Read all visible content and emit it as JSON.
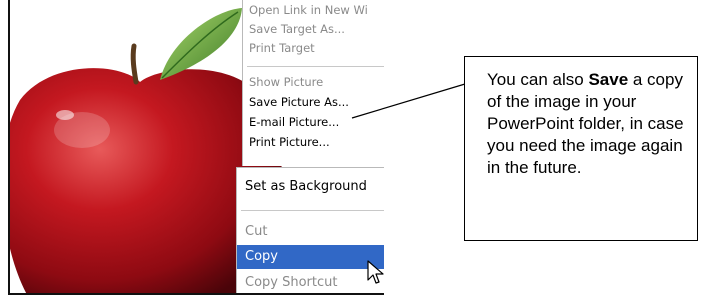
{
  "context_menu_top": {
    "items": [
      {
        "label": "Open Link in New Wi",
        "state": "disabled"
      },
      {
        "label": "Save Target As...",
        "state": "disabled"
      },
      {
        "label": "Print Target",
        "state": "disabled"
      },
      {
        "label": "Show Picture",
        "state": "disabled"
      },
      {
        "label": "Save Picture As...",
        "state": "enabled"
      },
      {
        "label": "E-mail Picture...",
        "state": "enabled"
      },
      {
        "label": "Print Picture...",
        "state": "enabled"
      }
    ]
  },
  "context_menu_bottom": {
    "items": [
      {
        "label": "Set as Background",
        "state": "enabled"
      },
      {
        "label": "Cut",
        "state": "disabled"
      },
      {
        "label": "Copy",
        "state": "highlighted"
      },
      {
        "label": "Copy Shortcut",
        "state": "disabled"
      }
    ],
    "highlight_color": "#3168c6"
  },
  "callout": {
    "text_before": "You can also ",
    "text_bold": "Save",
    "text_after": " a copy of the image in your PowerPoint folder, in case you need the image again in the future."
  },
  "cursor": {
    "icon": "arrow-pointer-icon"
  },
  "image": {
    "subject": "apple-icon",
    "colors": {
      "apple": "#b5121b",
      "leaf": "#6aa84f"
    }
  }
}
